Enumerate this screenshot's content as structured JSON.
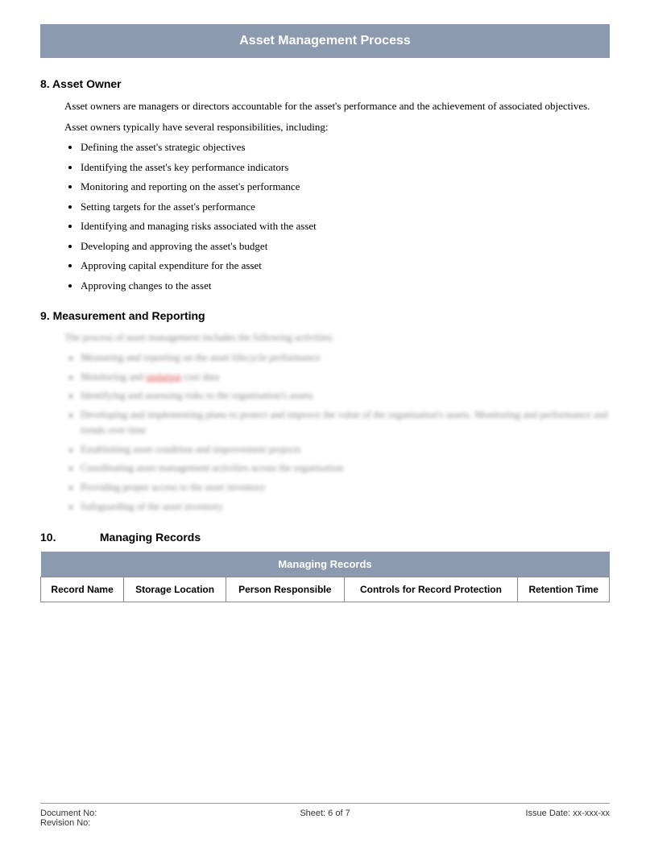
{
  "page": {
    "title": "Asset Management Process",
    "section8": {
      "heading": "8.  Asset Owner",
      "paragraph1": "Asset owners are managers or directors accountable for the asset's performance and the achievement of associated objectives.",
      "paragraph2": "Asset owners typically have several responsibilities, including:",
      "bullets": [
        "Defining the asset's strategic objectives",
        "Identifying the asset's key performance indicators",
        "Monitoring and reporting on the asset's performance",
        "Setting targets for the asset's performance",
        "Identifying and managing risks associated with the asset",
        "Developing and approving the asset's budget",
        "Approving capital expenditure for the asset",
        "Approving changes to the asset"
      ]
    },
    "section9": {
      "heading": "9.  Measurement and Reporting",
      "blurred_paragraph": "The process of asset management includes the following activities:",
      "blurred_bullets": [
        "Measuring and reporting on the asset lifecycle performance",
        "Monitoring and updating cost data",
        "Identifying and assessing risks to the organisation's assets",
        "Developing and implementing plans to protect and improve the value of the organisation's assets. Monitoring and performance and trends over time",
        "Establishing asset condition and improvement projects",
        "Coordinating asset management activities across the organisation",
        "Providing proper access to the asset inventory",
        "Safeguarding of the asset inventory"
      ],
      "blurred_red_word": "updating"
    },
    "section10": {
      "heading_number": "10.",
      "heading_text": "Managing Records",
      "table": {
        "title": "Managing Records",
        "columns": [
          "Record Name",
          "Storage Location",
          "Person Responsible",
          "Controls for Record Protection",
          "Retention Time"
        ]
      }
    },
    "footer": {
      "document_no_label": "Document No:",
      "revision_no_label": "Revision No:",
      "sheet": "Sheet: 6 of 7",
      "issue_date_label": "Issue Date:",
      "issue_date_value": "xx-xxx-xx"
    }
  }
}
